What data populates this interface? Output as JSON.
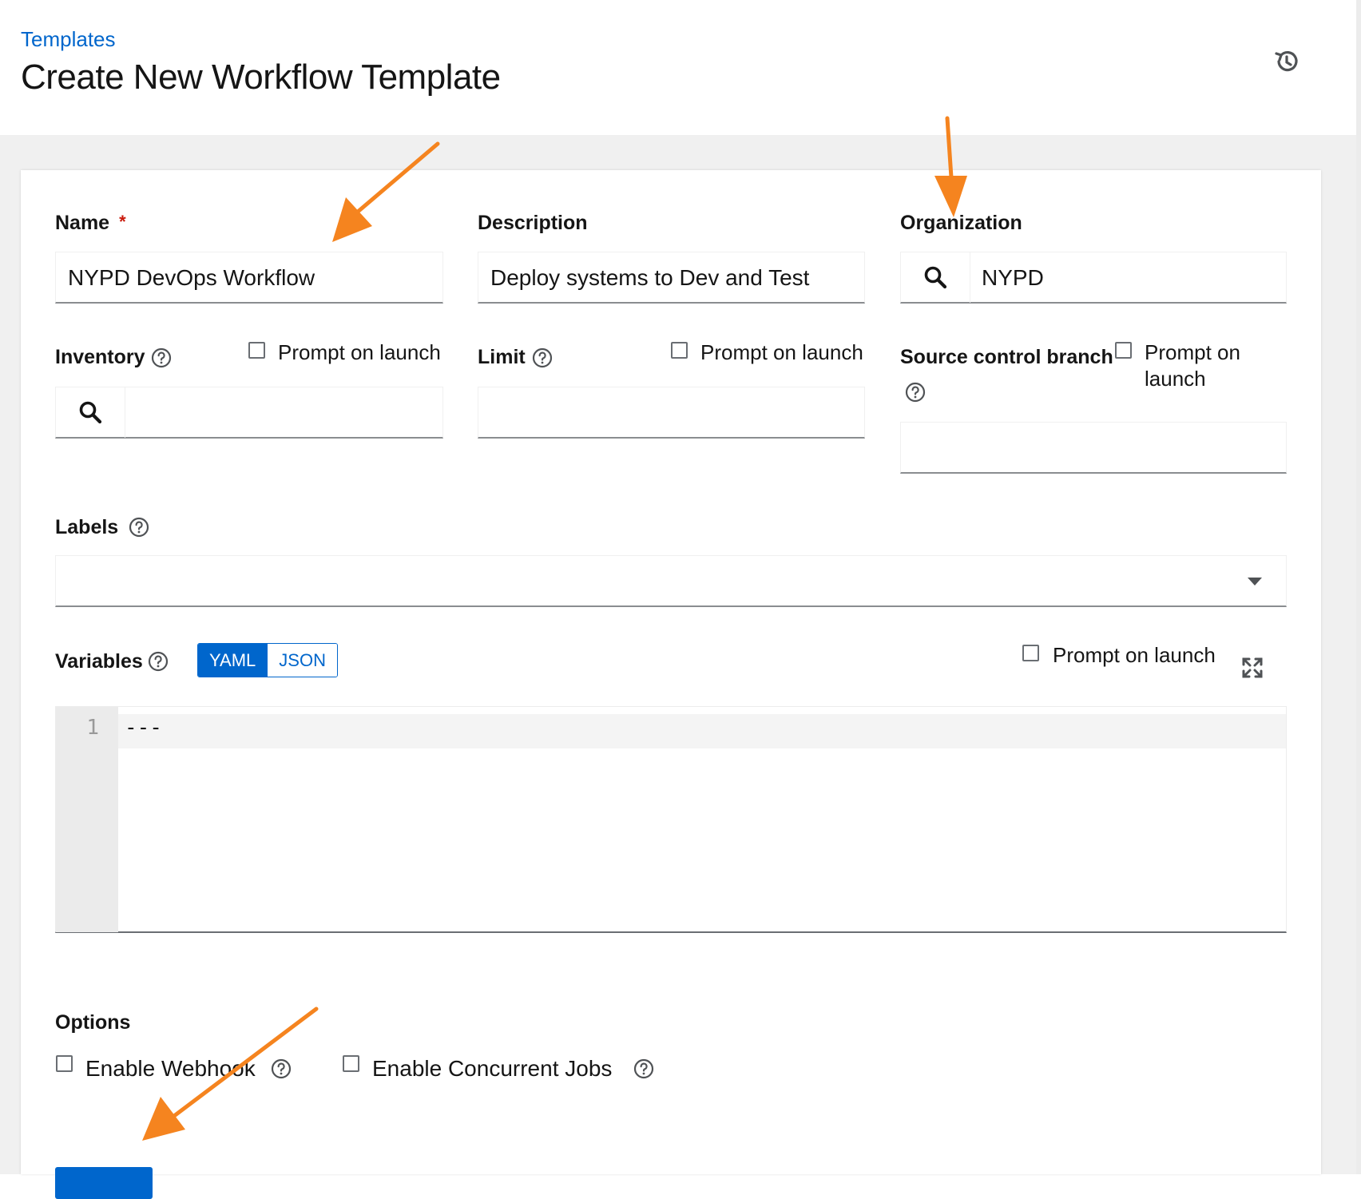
{
  "header": {
    "breadcrumb": "Templates",
    "title": "Create New Workflow Template",
    "history_icon": "history-icon"
  },
  "form": {
    "name": {
      "label": "Name",
      "required_marker": "*",
      "value": "NYPD DevOps Workflow"
    },
    "description": {
      "label": "Description",
      "value": "Deploy systems to Dev and Test"
    },
    "organization": {
      "label": "Organization",
      "value": "NYPD",
      "icon": "search-icon"
    },
    "inventory": {
      "label": "Inventory",
      "prompt_label": "Prompt on launch",
      "value": "",
      "icon": "search-icon"
    },
    "limit": {
      "label": "Limit",
      "prompt_label": "Prompt on launch",
      "value": ""
    },
    "scm_branch": {
      "label": "Source control branch",
      "prompt_label_line1": "Prompt on",
      "prompt_label_line2": "launch",
      "value": ""
    },
    "labels": {
      "label": "Labels",
      "value": ""
    },
    "variables": {
      "label": "Variables",
      "modes": [
        "YAML",
        "JSON"
      ],
      "active_mode": "YAML",
      "prompt_label": "Prompt on launch",
      "lines": [
        {
          "number": "1",
          "text": "---"
        }
      ]
    },
    "options": {
      "heading": "Options",
      "webhook_label": "Enable Webhook",
      "concurrent_label": "Enable Concurrent Jobs"
    }
  },
  "accent_color": "#0066cc",
  "annotation_color": "#f5841f"
}
